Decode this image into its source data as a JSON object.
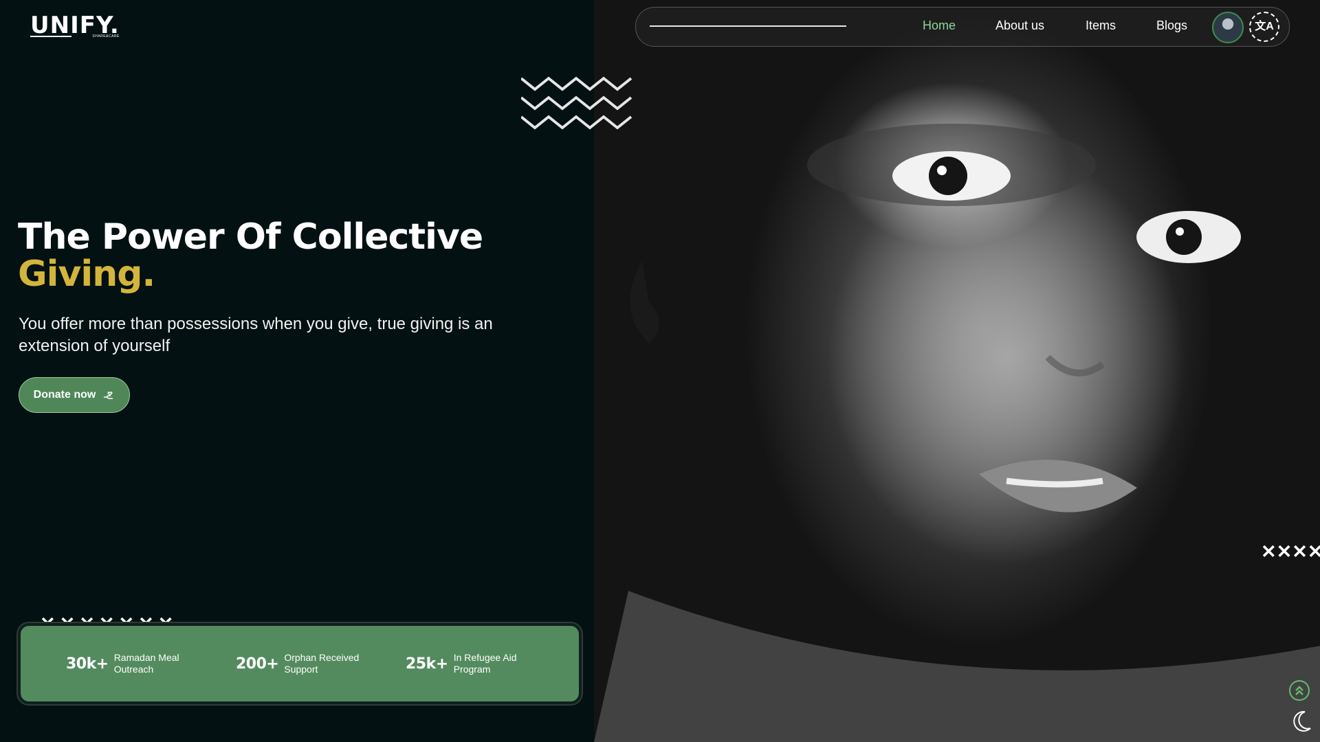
{
  "brand": {
    "name": "UNIFY.",
    "tagline": "SHARE&CARE"
  },
  "nav": {
    "items": [
      {
        "label": "Home",
        "active": true
      },
      {
        "label": "About us",
        "active": false
      },
      {
        "label": "Items",
        "active": false
      },
      {
        "label": "Blogs",
        "active": false
      }
    ],
    "translate_icon": "translate-icon",
    "avatar_icon": "user-avatar"
  },
  "hero": {
    "title_line1": "The Power Of Collective",
    "title_line2": "Giving.",
    "subtitle": "You offer more than possessions when you give, true giving is an extension of yourself",
    "cta_label": "Donate now",
    "cta_icon": "donate-hand-icon"
  },
  "stats": [
    {
      "value": "30k+",
      "label": "Ramadan Meal Outreach"
    },
    {
      "value": "200+",
      "label": "Orphan Received Support"
    },
    {
      "value": "25k+",
      "label": "In Refugee Aid Program"
    }
  ],
  "decor": {
    "x_row": "✕✕✕✕✕✕✕",
    "x_col": "✕✕✕✕✕✕✕"
  },
  "colors": {
    "background": "#031112",
    "accent_gold": "#d3b53c",
    "accent_green": "#538b5e",
    "nav_active": "#8fd49a"
  },
  "floating": {
    "scroll_top_icon": "double-chevron-up-icon",
    "theme_toggle_icon": "moon-icon"
  }
}
